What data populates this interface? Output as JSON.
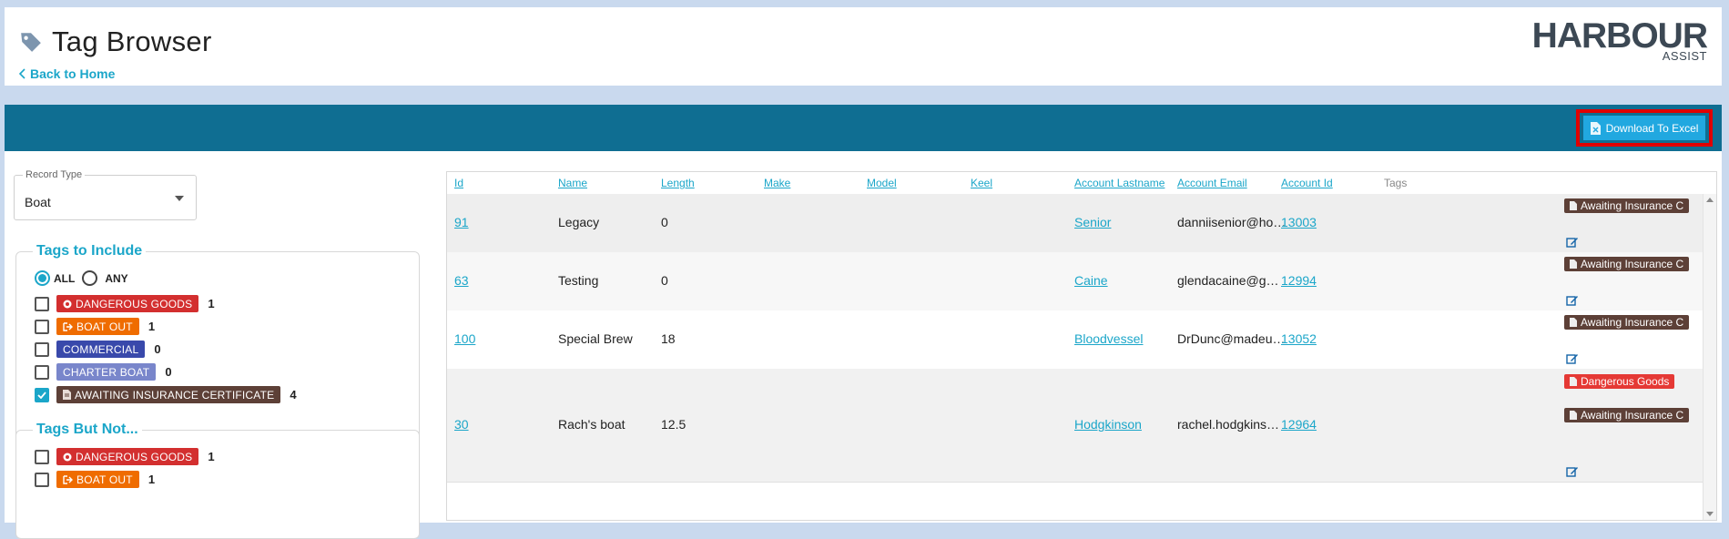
{
  "header": {
    "title": "Tag Browser",
    "back_label": "Back to Home",
    "logo_main": "HARBOUR",
    "logo_sub": "ASSIST"
  },
  "toolbar": {
    "download_label": "Download To Excel"
  },
  "record_type": {
    "label": "Record Type",
    "value": "Boat"
  },
  "include": {
    "title": "Tags to Include",
    "all_label": "ALL",
    "any_label": "ANY",
    "tags": [
      {
        "label": "DANGEROUS GOODS",
        "count": "1",
        "color": "#d32f2f",
        "checked": false
      },
      {
        "label": "BOAT OUT",
        "count": "1",
        "color": "#ef6c00",
        "checked": false
      },
      {
        "label": "COMMERCIAL",
        "count": "0",
        "color": "#3949ab",
        "checked": false
      },
      {
        "label": "CHARTER BOAT",
        "count": "0",
        "color": "#7986cb",
        "checked": false
      },
      {
        "label": "AWAITING INSURANCE CERTIFICATE",
        "count": "4",
        "color": "#5d4037",
        "checked": true
      }
    ]
  },
  "exclude": {
    "title": "Tags But Not...",
    "tags": [
      {
        "label": "DANGEROUS GOODS",
        "count": "1",
        "color": "#d32f2f",
        "checked": false
      },
      {
        "label": "BOAT OUT",
        "count": "1",
        "color": "#ef6c00",
        "checked": false
      }
    ]
  },
  "table": {
    "columns": [
      "Id",
      "Name",
      "Length",
      "Make",
      "Model",
      "Keel",
      "Account Lastname",
      "Account Email",
      "Account Id",
      "Tags"
    ],
    "rows": [
      {
        "id": "91",
        "name": "Legacy",
        "length": "0",
        "lastname": "Senior",
        "email": "danniisenior@ho…",
        "account_id": "13003",
        "tags": [
          {
            "label": "Awaiting Insurance C",
            "color": "#5d4037"
          }
        ]
      },
      {
        "id": "63",
        "name": "Testing",
        "length": "0",
        "lastname": "Caine",
        "email": "glendacaine@g…",
        "account_id": "12994",
        "tags": [
          {
            "label": "Awaiting Insurance C",
            "color": "#5d4037"
          }
        ]
      },
      {
        "id": "100",
        "name": "Special Brew",
        "length": "18",
        "lastname": "Bloodvessel",
        "email": "DrDunc@madeu…",
        "account_id": "13052",
        "tags": [
          {
            "label": "Awaiting Insurance C",
            "color": "#5d4037"
          }
        ]
      },
      {
        "id": "30",
        "name": "Rach's boat",
        "length": "12.5",
        "lastname": "Hodgkinson",
        "email": "rachel.hodgkins…",
        "account_id": "12964",
        "tags": [
          {
            "label": "Dangerous Goods",
            "color": "#e53935"
          },
          {
            "label": "Awaiting Insurance C",
            "color": "#5d4037"
          }
        ]
      }
    ]
  },
  "colors": {
    "accent": "#1ba6c9",
    "header_bar": "#0f6e92",
    "download_button": "#21a8e0",
    "highlight": "#e00000"
  }
}
